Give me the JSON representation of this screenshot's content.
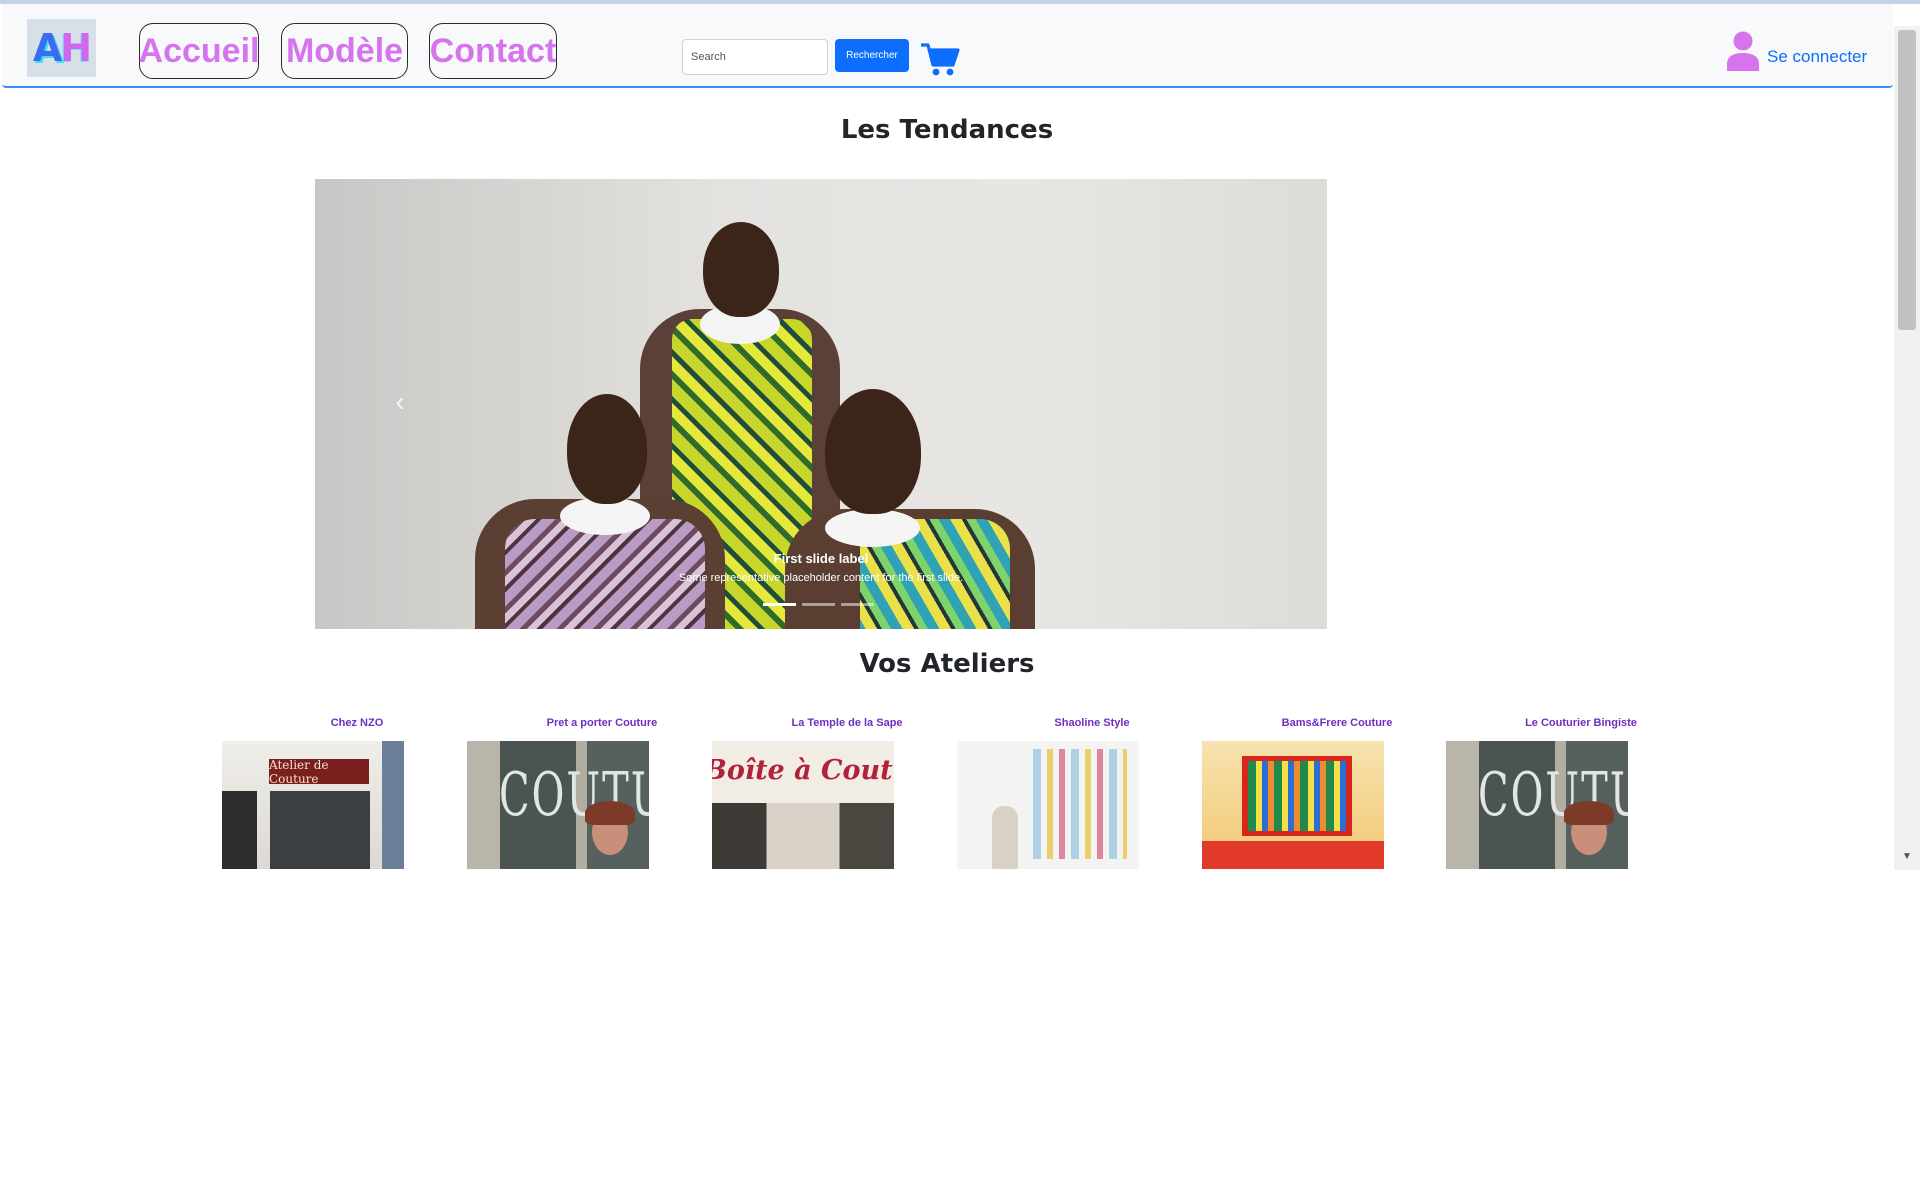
{
  "nav": {
    "logo_a": "A",
    "logo_h": "H",
    "links": [
      "Accueil",
      "Modèle",
      "Contact"
    ],
    "search_placeholder": "Search",
    "search_button": "Rechercher",
    "login_label": "Se connecter"
  },
  "trends": {
    "title": "Les Tendances",
    "slide": {
      "label": "First slide label",
      "text": "Some representative placeholder content for the first slide."
    },
    "slide_count": 3,
    "active_slide": 1
  },
  "workshops": {
    "title": "Vos Ateliers",
    "items": [
      {
        "name": "Chez NZO"
      },
      {
        "name": "Pret a porter Couture"
      },
      {
        "name": "La Temple de la Sape"
      },
      {
        "name": "Shaoline Style"
      },
      {
        "name": "Bams&Frere Couture"
      },
      {
        "name": "Le Couturier Bingiste"
      }
    ]
  },
  "images": {
    "shop1_sign": "Atelier de Couture",
    "shop2_window": "COUTURE",
    "shop3_sign": "Boîte à Couture",
    "shop6_window": "COUTURE"
  },
  "colors": {
    "nav_link": "#d574ec",
    "primary": "#0d6efd",
    "workshop_name": "#6f2ec3"
  }
}
